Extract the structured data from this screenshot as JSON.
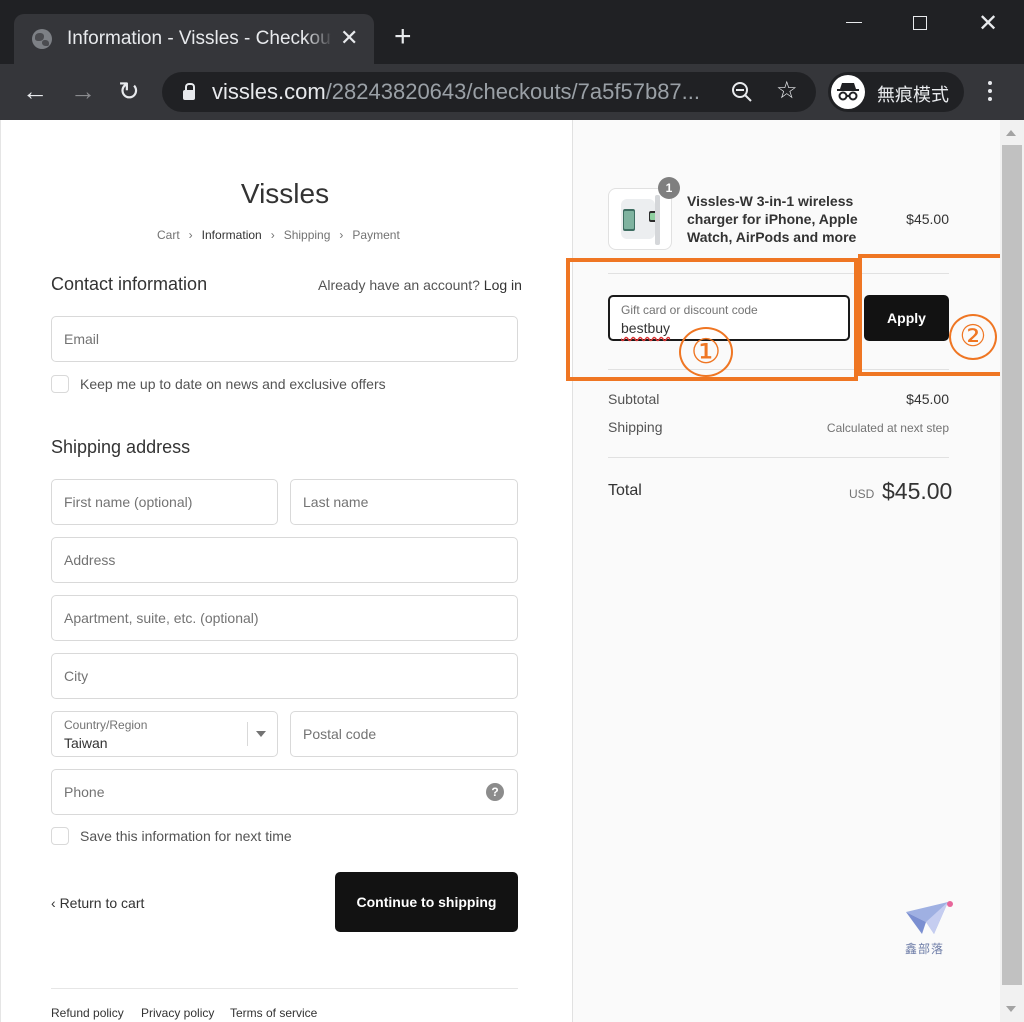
{
  "browser": {
    "tab_title": "Information - Vissles - Checkout",
    "tab_close": "✕",
    "new_tab": "+",
    "url_host": "vissles.com",
    "url_path": "/28243820643/checkouts/7a5f57b87...",
    "incognito_label": "無痕模式",
    "back": "←",
    "forward": "→",
    "reload": "↻",
    "win_close": "✕"
  },
  "store": {
    "name": "Vissles",
    "breadcrumbs": [
      "Cart",
      "Information",
      "Shipping",
      "Payment"
    ],
    "breadcrumb_sep": "›"
  },
  "contact": {
    "heading": "Contact information",
    "login_prompt": "Already have an account?",
    "login_link": "Log in",
    "email_placeholder": "Email",
    "newsletter_label": "Keep me up to date on news and exclusive offers"
  },
  "shipping": {
    "heading": "Shipping address",
    "first_name": "First name (optional)",
    "last_name": "Last name",
    "address": "Address",
    "apartment": "Apartment, suite, etc. (optional)",
    "city": "City",
    "country_label": "Country/Region",
    "country_value": "Taiwan",
    "postal": "Postal code",
    "phone": "Phone",
    "help": "?",
    "save_label": "Save this information for next time"
  },
  "actions": {
    "return_label": "Return to cart",
    "return_icon": "‹",
    "continue_label": "Continue to shipping"
  },
  "footer": {
    "links": [
      "Refund policy",
      "Privacy policy",
      "Terms of service"
    ]
  },
  "order": {
    "quantity": "1",
    "product_name": "Vissles-W 3-in-1 wireless charger for iPhone, Apple Watch, AirPods and more",
    "product_price": "$45.00",
    "discount_label": "Gift card or discount code",
    "discount_value": "bestbuy",
    "apply_label": "Apply",
    "subtotal_label": "Subtotal",
    "subtotal_value": "$45.00",
    "shipping_label": "Shipping",
    "shipping_value": "Calculated at next step",
    "total_label": "Total",
    "currency": "USD",
    "total_value": "$45.00"
  },
  "annotations": {
    "step1": "①",
    "step2": "②",
    "color": "#ef7623"
  },
  "watermark": {
    "text": "鑫部落"
  }
}
